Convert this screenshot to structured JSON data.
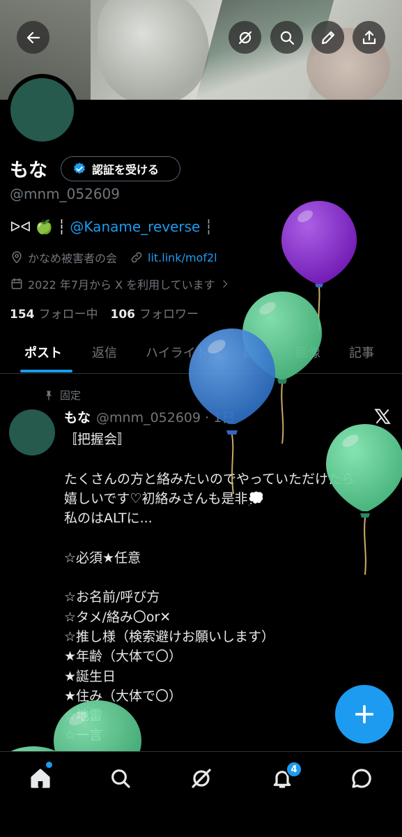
{
  "profile": {
    "name": "もな",
    "verify_label": "認証を受ける",
    "handle": "@mnm_052609",
    "bio_prefix": "ᐅᐊ 🍏 ┆",
    "bio_link": "@Kaname_reverse",
    "bio_suffix": "┆",
    "location": "かなめ被害者の会",
    "website": "lit.link/mof2l",
    "joined": "2022 年7月から X を利用しています",
    "following_count": "154",
    "following_label": "フォロー中",
    "followers_count": "106",
    "followers_label": "フォロワー"
  },
  "tabs": [
    "ポスト",
    "返信",
    "ハイライト",
    "動画",
    "画像",
    "記事"
  ],
  "post": {
    "pinned_label": "固定",
    "author_name": "もな",
    "author_handle": "@mnm_052609 · 1日",
    "text": "〚把握会〛\n\nたくさんの方と絡みたいのでやっていただけたら\n嬉しいです♡初絡みさんも是非💭\n私のはALTに...\n\n☆必須★任意\n\n☆お名前/呼び方\n☆タメ/絡み〇or✕\n☆推し様（検索避けお願いします）\n★年齢（大体で〇）\n★誕生日\n★住み（大体で〇）\n☆地雷\n☆一言"
  },
  "nav": {
    "notifications_badge": "4"
  },
  "colors": {
    "accent": "#1d9bf0",
    "avatar": "#255a4d",
    "balloon_purple": "#8e2fd0",
    "balloon_green": "#5fd49a",
    "balloon_blue": "#3b82d8"
  },
  "icons": [
    "back-arrow-icon",
    "grok-icon",
    "search-icon",
    "pencil-icon",
    "share-icon",
    "verified-badge-icon",
    "location-icon",
    "link-icon",
    "calendar-icon",
    "chevron-right-icon",
    "pin-icon",
    "x-logo-icon",
    "plus-icon",
    "home-icon",
    "bell-icon",
    "chat-icon"
  ]
}
